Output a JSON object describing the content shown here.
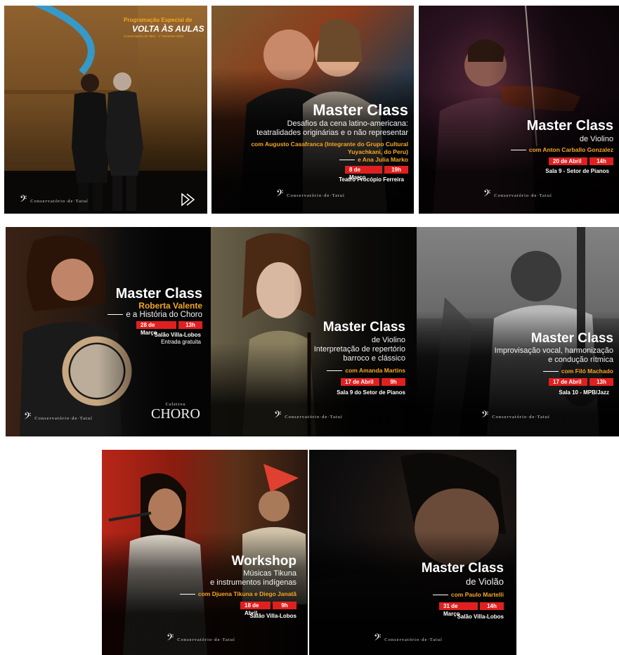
{
  "logo_text": "Conservatório·de·Tatuí",
  "cards": [
    {
      "header_top": "Programação Especial de",
      "header_main": "VOLTA ÀS AULAS",
      "header_small": "Conservatório de Tatuí · 1º Semestre 2025",
      "logo": "Conservatório·de·Tatuí"
    },
    {
      "title": "Master Class",
      "line1": "Desafios da cena latino-americana:",
      "line2": "teatralidades originárias e o não representar",
      "guest1": "com Augusto Casafranca (Integrante do Grupo Cultural",
      "guest2": "Yuyachkani, do Peru)",
      "guest3": "e Ana Julia Marko",
      "date": "8 de Março",
      "hour": "19h",
      "venue": "Teatro Procópio Ferreira",
      "logo": "Conservatório·de·Tatuí"
    },
    {
      "title": "Master Class",
      "line1": "de Violino",
      "guest": "com Anton Carballo Gonzalez",
      "date": "20 de Abril",
      "hour": "14h",
      "venue": "Sala 9 - Setor de Pianos",
      "logo": "Conservatório·de·Tatuí"
    },
    {
      "title": "Master Class",
      "name": "Roberta Valente",
      "line1": "e a História do Choro",
      "date": "28 de Março",
      "hour": "13h",
      "venue": "Salão Villa-Lobos",
      "venue2": "Entrada gratuita",
      "logo": "Conservatório·de·Tatuí",
      "choro_small": "Coletivo",
      "choro": "CHORO"
    },
    {
      "title": "Master Class",
      "line1": "de Violino",
      "line2": "Interpretação de repertório",
      "line3": "barroco e clássico",
      "guest": "com Amanda Martins",
      "date": "17 de Abril",
      "hour": "9h",
      "venue": "Sala 9 do Setor de Pianos",
      "logo": "Conservatório·de·Tatuí"
    },
    {
      "title": "Master Class",
      "line1": "Improvisação vocal, harmonização",
      "line2": "e condução rítmica",
      "guest": "com Filó Machado",
      "date": "17 de Abril",
      "hour": "13h",
      "venue": "Sala 10 - MPB/Jazz",
      "logo": "Conservatório·de·Tatuí"
    },
    {
      "title": "Workshop",
      "line1": "Músicas Tikuna",
      "line2": "e instrumentos indígenas",
      "guest": "com Djuena Tikuna e Diego Janatã",
      "date": "18 de Abril",
      "hour": "9h",
      "venue": "Salão Villa-Lobos",
      "logo": "Conservatório·de·Tatuí"
    },
    {
      "title": "Master Class",
      "line1": "de Violão",
      "guest": "com Paulo Martelli",
      "date": "31 de Março",
      "hour": "14h",
      "venue": "Salão Villa-Lobos",
      "logo": "Conservatório·de·Tatuí"
    }
  ]
}
